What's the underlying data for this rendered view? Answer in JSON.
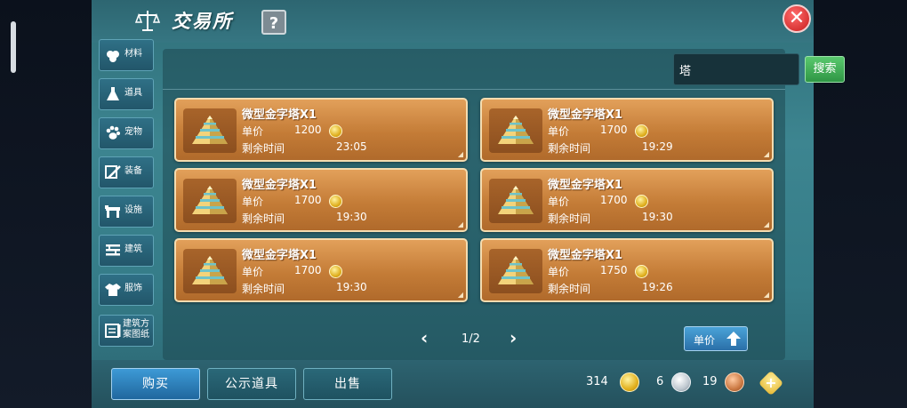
{
  "window": {
    "title": "交易所",
    "help": "?",
    "close": "✕"
  },
  "sidebar": {
    "items": [
      {
        "label": "材料",
        "icon": "material-icon"
      },
      {
        "label": "道具",
        "icon": "flask-icon"
      },
      {
        "label": "宠物",
        "icon": "paw-icon"
      },
      {
        "label": "装备",
        "icon": "sword-icon"
      },
      {
        "label": "设施",
        "icon": "facility-icon"
      },
      {
        "label": "建筑",
        "icon": "building-icon"
      },
      {
        "label": "服饰",
        "icon": "clothing-icon"
      },
      {
        "label": "建筑方案图纸",
        "icon": "blueprint-icon"
      }
    ]
  },
  "search": {
    "value": "塔",
    "button_label": "搜索"
  },
  "listing_labels": {
    "price": "单价",
    "remaining": "剩余时间"
  },
  "listings": [
    {
      "name": "微型金字塔X1",
      "price": "1200",
      "time": "23:05"
    },
    {
      "name": "微型金字塔X1",
      "price": "1700",
      "time": "19:29"
    },
    {
      "name": "微型金字塔X1",
      "price": "1700",
      "time": "19:30"
    },
    {
      "name": "微型金字塔X1",
      "price": "1700",
      "time": "19:30"
    },
    {
      "name": "微型金字塔X1",
      "price": "1700",
      "time": "19:30"
    },
    {
      "name": "微型金字塔X1",
      "price": "1750",
      "time": "19:26"
    }
  ],
  "pagination": {
    "text": "1/2",
    "prev": "‹",
    "next": "›"
  },
  "sort": {
    "label": "单价"
  },
  "bottom": {
    "buy": "购买",
    "display": "公示道具",
    "sell": "出售"
  },
  "currency": {
    "gold": "314",
    "silver": "6",
    "bronze": "19"
  },
  "colors": {
    "accent_green": "#3fae55",
    "card_orange": "#c47c37",
    "primary_blue": "#2a7fc0"
  }
}
